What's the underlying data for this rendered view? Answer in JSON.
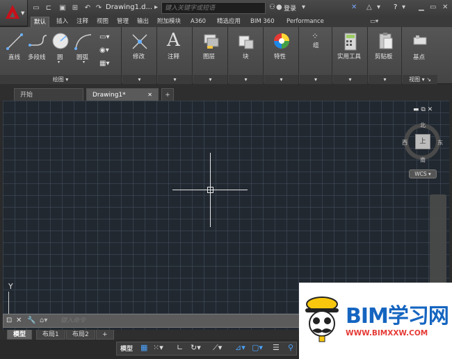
{
  "titlebar": {
    "doc_title": "Drawing1.d...",
    "search_placeholder": "键入关键字或短语",
    "login_label": "登录",
    "help_label": "?"
  },
  "ribbon_tabs": [
    "默认",
    "插入",
    "注释",
    "视图",
    "管理",
    "输出",
    "附加模块",
    "A360",
    "精选应用",
    "BIM 360",
    "Performance"
  ],
  "ribbon": {
    "draw_panel": {
      "line_label": "直线",
      "polyline_label": "多段线",
      "circle_label": "圆",
      "arc_label": "圆弧",
      "footer": "绘图"
    },
    "modify_label": "修改",
    "annotation_label": "注释",
    "layers_label": "图层",
    "block_label": "块",
    "properties_label": "特性",
    "groups_label": "组",
    "utilities_label": "实用工具",
    "clipboard_label": "剪贴板",
    "view_panel": {
      "base_label": "基点",
      "footer": "视图"
    }
  },
  "file_tabs": [
    "开始",
    "Drawing1*"
  ],
  "viewcube": {
    "top": "上",
    "north": "北",
    "south": "南",
    "east": "东",
    "west": "西",
    "wcs": "WCS"
  },
  "ucs_axis": "Y",
  "command_line": {
    "placeholder": "键入命令"
  },
  "layout_tabs": [
    "模型",
    "布局1",
    "布局2"
  ],
  "status_bar": {
    "model_label": "模型"
  },
  "watermark": {
    "brand": "BIM学习网",
    "url": "WWW.BIMXXW.COM"
  },
  "colors": {
    "app_red": "#c8101a",
    "canvas_bg": "#212830",
    "brand_blue": "#1565c0",
    "url_red": "#e53935"
  }
}
